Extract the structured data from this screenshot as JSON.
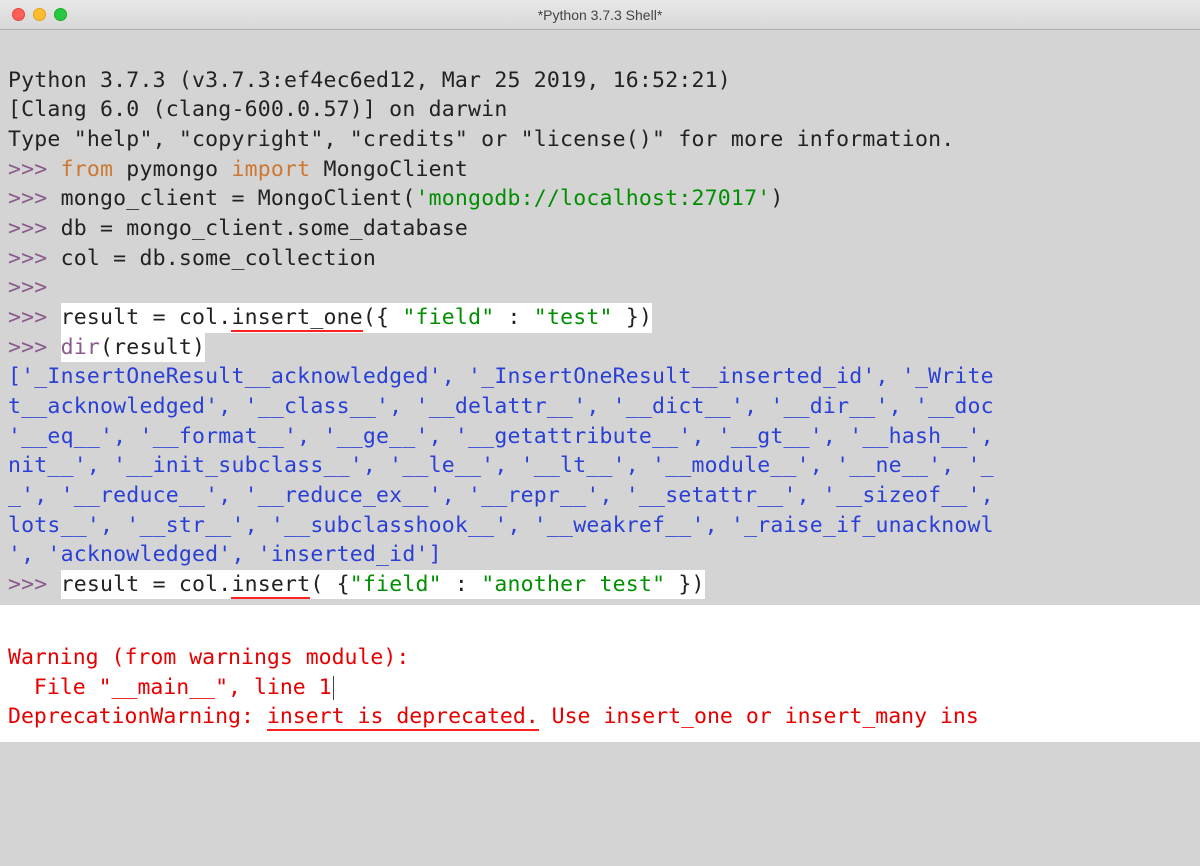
{
  "title": "*Python 3.7.3 Shell*",
  "banner": {
    "l1": "Python 3.7.3 (v3.7.3:ef4ec6ed12, Mar 25 2019, 16:52:21) ",
    "l2": "[Clang 6.0 (clang-600.0.57)] on darwin",
    "l3_a": "Type \"help\", \"copyright\", \"credits\" or \"license()\" for more information."
  },
  "prompt": ">>> ",
  "code": {
    "from": "from",
    "import": "import",
    "pymongo": " pymongo ",
    "mongoclient": " MongoClient",
    "line2_a": "mongo_client = MongoClient(",
    "line2_str": "'mongodb://localhost:27017'",
    "line2_b": ")",
    "line3": "db = mongo_client.some_database",
    "line4": "col = db.some_collection",
    "line6_a": "result = col.",
    "line6_b": "insert_one",
    "line6_c": "({ ",
    "line6_d": "\"field\"",
    "line6_e": " : ",
    "line6_f": "\"test\"",
    "line6_g": " })",
    "dir": "dir",
    "line7_b": "(result)",
    "dir_out1": "['_InsertOneResult__acknowledged', '_InsertOneResult__inserted_id', '_Write",
    "dir_out2": "t__acknowledged', '__class__', '__delattr__', '__dict__', '__dir__', '__doc",
    "dir_out3": "'__eq__', '__format__', '__ge__', '__getattribute__', '__gt__', '__hash__',",
    "dir_out4": "nit__', '__init_subclass__', '__le__', '__lt__', '__module__', '__ne__', '_",
    "dir_out5": "_', '__reduce__', '__reduce_ex__', '__repr__', '__setattr__', '__sizeof__',",
    "dir_out6": "lots__', '__str__', '__subclasshook__', '__weakref__', '_raise_if_unacknowl",
    "dir_out7": "', 'acknowledged', 'inserted_id']",
    "line8_a": "result = col.",
    "line8_b": "insert",
    "line8_c": "( {",
    "line8_d": "\"field\"",
    "line8_e": " : ",
    "line8_f": "\"another test\"",
    "line8_g": " })"
  },
  "warning": {
    "l1": "Warning (from warnings module):",
    "l2a": "  File \"__main__\", line 1",
    "l3a": "DeprecationWarning: ",
    "l3b": "insert is deprecated.",
    "l3c": " Use insert_one or insert_many ins"
  }
}
